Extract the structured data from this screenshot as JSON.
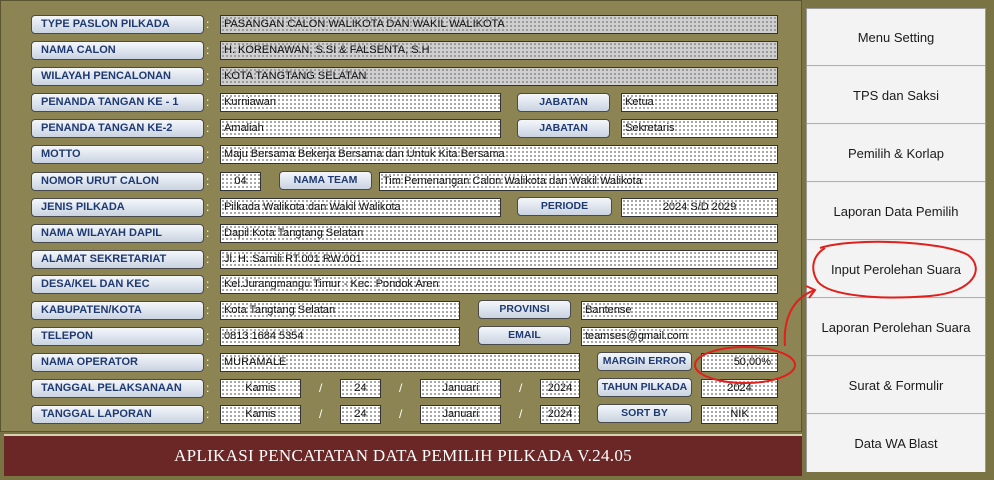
{
  "form": {
    "rows": [
      {
        "label": "TYPE PASLON PILKADA",
        "value": "PASANGAN CALON WALIKOTA DAN WAKIL WALIKOTA"
      },
      {
        "label": "NAMA CALON",
        "value": "H. KORENAWAN, S.SI & FALSENTA, S.H"
      },
      {
        "label": "WILAYAH PENCALONAN",
        "value": "KOTA TANGTANG SELATAN"
      },
      {
        "label": "PENANDA TANGAN KE - 1",
        "value": "Kurniawan",
        "sub_label": "JABATAN",
        "sub_value": "Ketua"
      },
      {
        "label": "PENANDA TANGAN KE-2",
        "value": "Amaliah",
        "sub_label": "JABATAN",
        "sub_value": "Sekretaris"
      },
      {
        "label": "MOTTO",
        "value": "Maju Bersama Bekerja Bersama dan Untuk Kita Bersama"
      },
      {
        "label": "NOMOR URUT CALON",
        "value": "04",
        "sub_label": "NAMA TEAM",
        "sub_value": "Tim Pemenangan Calon Walikota dan Wakil Walikota"
      },
      {
        "label": "JENIS PILKADA",
        "value": "Pilkada Walikota dan Wakil Walikota",
        "sub_label": "PERIODE",
        "sub_value": "2024 S/D 2029"
      },
      {
        "label": "NAMA WILAYAH DAPIL",
        "value": "Dapil Kota Tangtang Selatan"
      },
      {
        "label": "ALAMAT SEKRETARIAT",
        "value": "Jl. H. Samili RT.001 RW.001"
      },
      {
        "label": "DESA/KEL DAN KEC",
        "value": "Kel.Jurangmangu Timur - Kec. Pondok Aren"
      },
      {
        "label": "KABUPATEN/KOTA",
        "value": "Kota Tangtang Selatan",
        "sub_label": "PROVINSI",
        "sub_value": "Bantense"
      },
      {
        "label": "TELEPON",
        "value": "0813 1684 5354",
        "sub_label": "EMAIL",
        "sub_value": "teamses@gmail.com"
      },
      {
        "label": "NAMA OPERATOR",
        "value": "MURAMALE",
        "sub_label": "MARGIN ERROR",
        "sub_value": "50,00%"
      }
    ],
    "tanggal_pelaksanaan": {
      "label": "TANGGAL PELAKSANAAN",
      "day": "Kamis",
      "date": "24",
      "month": "Januari",
      "year": "2024",
      "sub_label": "TAHUN PILKADA",
      "sub_value": "2024"
    },
    "tanggal_laporan": {
      "label": "TANGGAL LAPORAN",
      "day": "Kamis",
      "date": "24",
      "month": "Januari",
      "year": "2024",
      "sub_label": "SORT BY",
      "sub_value": "NIK"
    },
    "separator": ":",
    "slash": "/"
  },
  "footer": {
    "title": "APLIKASI PENCATATAN DATA PEMILIH PILKADA V.24.05"
  },
  "menu": {
    "items": [
      "Menu Setting",
      "TPS dan Saksi",
      "Pemilih & Korlap",
      "Laporan Data Pemilih",
      "Input Perolehan Suara",
      "Laporan Perolehan Suara",
      "Surat & Formulir",
      "Data WA Blast"
    ]
  },
  "colors": {
    "annotation": "#e0201c",
    "footer_bg": "#6b2626",
    "panel_bg": "#8c8553"
  }
}
